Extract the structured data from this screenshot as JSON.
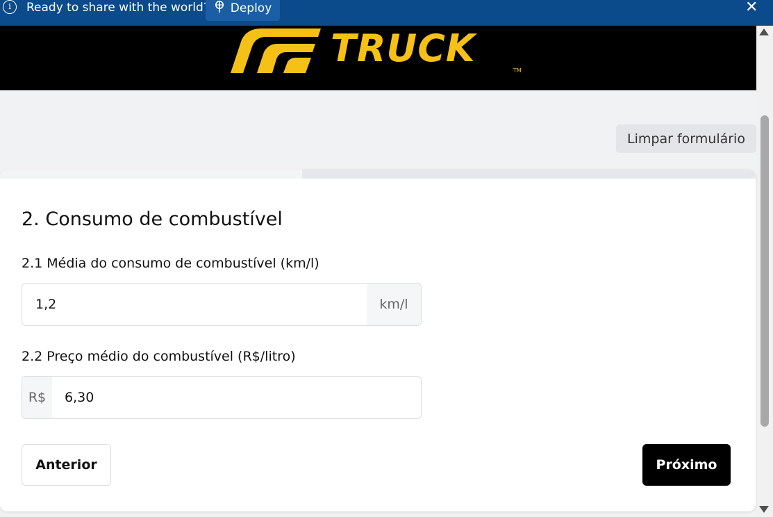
{
  "notification": {
    "message": "Ready to share with the world?",
    "deploy_label": "Deploy",
    "info_icon": "info-icon",
    "deploy_icon": "deploy-icon",
    "close_icon": "close-icon"
  },
  "banner": {
    "logo_text": "TRUCK",
    "logo_tm": "TM",
    "brand_color": "#f5c117"
  },
  "toolbar": {
    "clear_label": "Limpar formulário"
  },
  "progress": {
    "fraction": 0.4
  },
  "form": {
    "section_title": "2. Consumo de combustível",
    "fuel_consumption": {
      "label": "2.1 Média do consumo de combustível (km/l)",
      "value": "1,2",
      "suffix": "km/l"
    },
    "fuel_price": {
      "label": "2.2 Preço médio do combustível (R$/litro)",
      "prefix": "R$",
      "value": "6,30"
    }
  },
  "nav": {
    "prev_label": "Anterior",
    "next_label": "Próximo"
  }
}
